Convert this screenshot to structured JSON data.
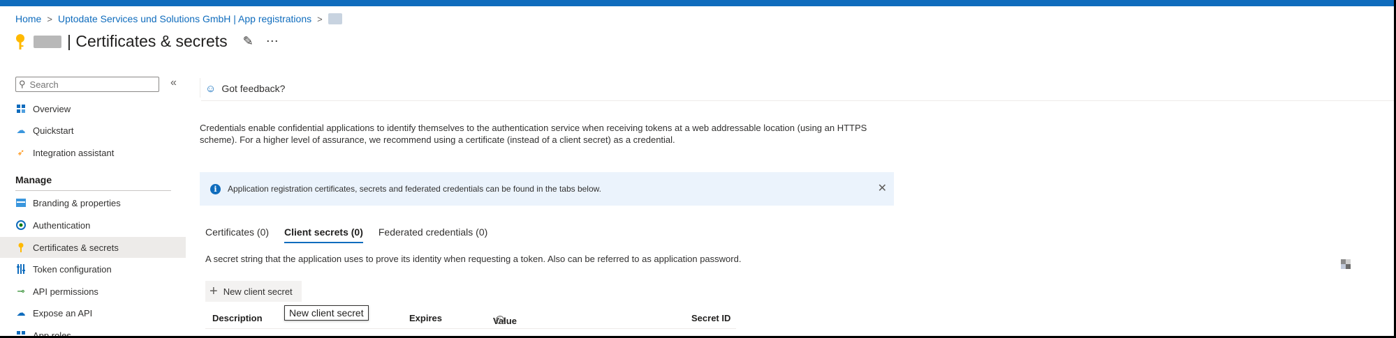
{
  "breadcrumb": {
    "home": "Home",
    "tenant": "Uptodate Services und Solutions GmbH | App registrations"
  },
  "page": {
    "title": "| Certificates & secrets"
  },
  "sidebar": {
    "search_placeholder": "Search",
    "items": [
      {
        "label": "Overview"
      },
      {
        "label": "Quickstart"
      },
      {
        "label": "Integration assistant"
      }
    ],
    "manage_heading": "Manage",
    "manage_items": [
      {
        "label": "Branding & properties"
      },
      {
        "label": "Authentication"
      },
      {
        "label": "Certificates & secrets"
      },
      {
        "label": "Token configuration"
      },
      {
        "label": "API permissions"
      },
      {
        "label": "Expose an API"
      },
      {
        "label": "App roles"
      }
    ]
  },
  "toolbar": {
    "feedback_label": "Got feedback?"
  },
  "main": {
    "description": "Credentials enable confidential applications to identify themselves to the authentication service when receiving tokens at a web addressable location (using an HTTPS scheme). For a higher level of assurance, we recommend using a certificate (instead of a client secret) as a credential.",
    "info_message": "Application registration certificates, secrets and federated credentials can be found in the tabs below.",
    "tabs": [
      {
        "label": "Certificates (0)"
      },
      {
        "label": "Client secrets (0)"
      },
      {
        "label": "Federated credentials (0)"
      }
    ],
    "tab_description": "A secret string that the application uses to prove its identity when requesting a token. Also can be referred to as application password.",
    "new_secret_label": "New client secret",
    "table_headers": {
      "description": "Description",
      "expires": "Expires",
      "value": "Value",
      "secret_id": "Secret ID"
    },
    "tooltip": "New client secret"
  },
  "colors": {
    "accent": "#0f6cbd",
    "info_bg": "#ebf3fc",
    "active_nav": "#edebe9"
  }
}
